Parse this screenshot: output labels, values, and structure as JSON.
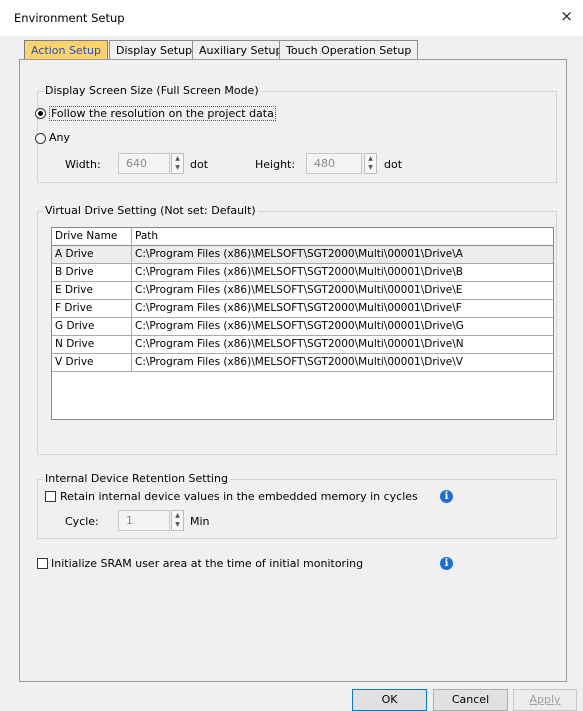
{
  "window": {
    "title": "Environment Setup",
    "close_glyph": "×"
  },
  "tabs": [
    {
      "label": "Action Setup",
      "active": true
    },
    {
      "label": "Display Setup",
      "active": false
    },
    {
      "label": "Auxiliary Setup",
      "active": false
    },
    {
      "label": "Touch Operation Setup",
      "active": false
    }
  ],
  "display_size": {
    "legend": "Display Screen Size (Full Screen Mode)",
    "option_follow": "Follow the resolution on the project data",
    "option_any": "Any",
    "selected": "follow",
    "width_label": "Width:",
    "width_value": "640",
    "height_label": "Height:",
    "height_value": "480",
    "unit": "dot"
  },
  "virtual_drive": {
    "legend": "Virtual Drive Setting (Not set: Default)",
    "columns": [
      "Drive Name",
      "Path"
    ],
    "rows": [
      [
        "A Drive",
        "C:\\Program Files (x86)\\MELSOFT\\SGT2000\\Multi\\00001\\Drive\\A"
      ],
      [
        "B Drive",
        "C:\\Program Files (x86)\\MELSOFT\\SGT2000\\Multi\\00001\\Drive\\B"
      ],
      [
        "E Drive",
        "C:\\Program Files (x86)\\MELSOFT\\SGT2000\\Multi\\00001\\Drive\\E"
      ],
      [
        "F Drive",
        "C:\\Program Files (x86)\\MELSOFT\\SGT2000\\Multi\\00001\\Drive\\F"
      ],
      [
        "G Drive",
        "C:\\Program Files (x86)\\MELSOFT\\SGT2000\\Multi\\00001\\Drive\\G"
      ],
      [
        "N Drive",
        "C:\\Program Files (x86)\\MELSOFT\\SGT2000\\Multi\\00001\\Drive\\N"
      ],
      [
        "V Drive",
        "C:\\Program Files (x86)\\MELSOFT\\SGT2000\\Multi\\00001\\Drive\\V"
      ]
    ]
  },
  "retention": {
    "legend": "Internal Device Retention Setting",
    "checkbox_label": "Retain internal device values in the embedded memory in cycles",
    "cycle_label": "Cycle:",
    "cycle_value": "1",
    "cycle_unit": "Min"
  },
  "sram": {
    "checkbox_label": "Initialize SRAM user area at the time of initial monitoring"
  },
  "info_glyph": "i",
  "spin_up": "▲",
  "spin_down": "▼",
  "buttons": {
    "ok": "OK",
    "cancel": "Cancel",
    "apply": "Apply"
  },
  "colors": {
    "active_tab": "#ffd36b",
    "info_icon": "#1f6fd0"
  }
}
